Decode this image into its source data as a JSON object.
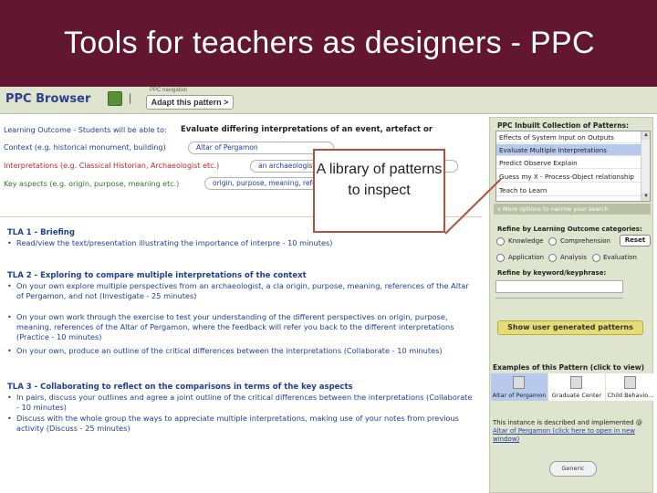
{
  "slide": {
    "title": "Tools for teachers as designers - PPC"
  },
  "toolbar": {
    "brand": "PPC Browser",
    "separator": "|",
    "nav_caption": "PPC navigation",
    "adapt_label": "Adapt this pattern >"
  },
  "learning_outcome": {
    "label": "Learning Outcome - Students will be able to:",
    "value": "Evaluate differing interpretations of an event, artefact or",
    "context_label": "Context (e.g. historical monument, building)",
    "context_value": "Altar of Pergamon",
    "interpretations_label": "Interpretations (e.g. Classical Historian, Archaeologist etc.)",
    "interpretations_value": "an archaeologist, a classicist, and a modern historian",
    "key_aspects_label": "Key aspects (e.g. origin, purpose, meaning etc.)",
    "key_aspects_value": "origin, purpose, meaning, references"
  },
  "tlas": [
    {
      "heading": "TLA 1 - Briefing",
      "items": [
        "Read/view the text/presentation illustrating the importance of interpre                              - 10 minutes)"
      ]
    },
    {
      "heading": "TLA 2 - Exploring to compare multiple interpretations of the context",
      "items": [
        "On your own explore multiple perspectives from an archaeologist, a cla                               origin, purpose, meaning, references of the Altar of Pergamon, and not (Investigate - 25 minutes)",
        "On your own work through the exercise to test your understanding of the different perspectives on origin, purpose, meaning, references of the Altar of Pergamon, where the feedback will refer you back to the different interpretations (Practice - 10 minutes)",
        "On your own, produce an outline of the critical differences between the interpretations (Collaborate - 10 minutes)"
      ]
    },
    {
      "heading": "TLA 3 - Collaborating to reflect on the comparisons in terms of the key aspects",
      "items": [
        "In pairs, discuss your outlines and agree a joint outline of the critical differences between the interpretations (Collaborate - 10 minutes)",
        "Discuss with the whole group the ways to appreciate multiple interpretations, making use of your notes from previous activity (Discuss - 25 minutes)"
      ]
    }
  ],
  "callout": {
    "text": "A library of patterns to inspect"
  },
  "sidebar": {
    "inbuilt_title": "PPC Inbuilt  Collection of Patterns:",
    "patterns": [
      "Effects of System Input on Outputs",
      "Evaluate Multiple Interpretations",
      "Predict Observe Explain",
      "Guess my X - Process-Object relationship",
      "Teach to Learn"
    ],
    "selected_pattern_index": 1,
    "more_options": "v More options to narrow your search",
    "refine_lo_label": "Refine by Learning Outcome categories:",
    "categories": [
      "Knowledge",
      "Comprehension",
      "Application",
      "Analysis",
      "Evaluation"
    ],
    "reset_label": "Reset",
    "refine_kw_label": "Refine by  keyword/keyphrase:",
    "show_user_label": "Show user generated patterns",
    "examples_title": "Examples of this Pattern (click to view)",
    "examples": [
      "Altar of Pergamon",
      "Graduate Center",
      "Child Behavio..."
    ],
    "selected_example_index": 0,
    "example_desc_prefix": "This instance is described and implemented @ ",
    "example_desc_link": "Altar of Pergamon (click here to open in new window)",
    "generic_label": "Generic"
  },
  "colors": {
    "title_bar": "#62162f",
    "panel_bg": "#dfe4cf",
    "label_blue": "#1f3f95",
    "label_red": "#c0252c",
    "label_green": "#2c7a2c",
    "callout_border": "#b4503f",
    "show_user_btn": "#e6dd77",
    "selection": "#b7c9ec"
  }
}
